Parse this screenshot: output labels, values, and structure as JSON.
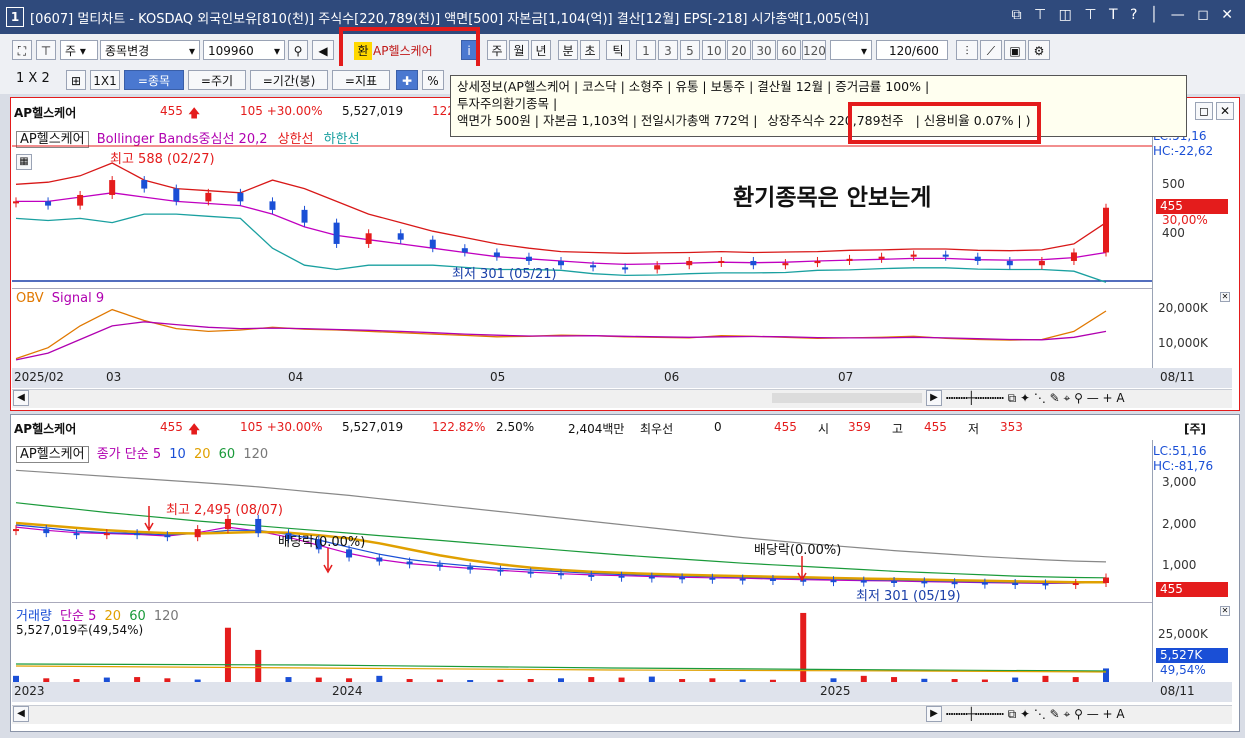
{
  "window": {
    "number": "1",
    "title": "[0607] 멀티차트 - KOSDAQ 외국인보유[810(천)] 주식수[220,789(천)] 액면[500] 자본금[1,104(억)] 결산[12월] EPS[-218] 시가총액[1,005(억)]",
    "icons": "⧉ ⊤ ◫ ⊤ T ? │ — ◻ ✕"
  },
  "toolbar1": {
    "period_sel": "주",
    "change_btn": "종목변경",
    "code": "109960",
    "badge": "환",
    "stock_name": "AP헬스케어",
    "tabs": [
      "주",
      "월",
      "년",
      "분",
      "초",
      "틱"
    ],
    "nums": [
      "1",
      "3",
      "5",
      "10",
      "20",
      "30",
      "60",
      "120"
    ],
    "count": "120",
    "total": "/600"
  },
  "toolbar2": {
    "layout1": "1 X 2",
    "layout2": "1X1",
    "b1": "=종목",
    "b2": "=주기",
    "b3": "=기간(봉)",
    "b4": "=지표"
  },
  "tooltip": {
    "line1": "상세정보(AP헬스케어  | 코스닥  | 소형주  | 유통  | 보통주  | 결산월 12월  | 증거금률 100%  |",
    "line2": "투자주의환기종목  |",
    "line3a": "액면가 500원  | 자본금 1,103억  | 전일시가총액 772억  |",
    "line3b": "상장주식수 220,789천주",
    "line3c": "|  신용비율 0.07%  |  )"
  },
  "annotation": "환기종목은 안보는게",
  "top_chart": {
    "name": "AP헬스케어",
    "price": "455",
    "change": "105 +30.00%",
    "volume": "5,527,019",
    "pct": "122",
    "legend_name": "AP헬스케어",
    "legend_bb": "Bollinger Bands중심선 20,2",
    "legend_up": "상한선",
    "legend_dn": "하한선",
    "high_label": "최고 588 (02/27)",
    "low_label": "최저 301 (05/21)",
    "lc": "LC:51,16",
    "hc": "HC:-22,62",
    "y_labels": [
      "500",
      "400"
    ],
    "price_tag": "455",
    "pct_tag": "30,00%",
    "obv_legend": "OBV",
    "obv_signal": "Signal 9",
    "obv_y": [
      "20,000K",
      "10,000K"
    ],
    "x_labels": [
      "2025/02",
      "03",
      "04",
      "05",
      "06",
      "07",
      "08"
    ],
    "date_end": "08/11",
    "bottom_icons": "┅┅┅┼┅┅┅┅ ⧉ ✦ ⋱ ✎ ⌖ ⚲ — + A"
  },
  "bottom_chart": {
    "name": "AP헬스케어",
    "price": "455",
    "change": "105 +30.00%",
    "volume": "5,527,019",
    "pct": "122.82%",
    "pct2": "2.50%",
    "amount": "2,404백만",
    "bid_label": "최우선",
    "bid": "0",
    "ask": "455",
    "open_l": "시",
    "open": "359",
    "high_l": "고",
    "high": "455",
    "low_l": "저",
    "low": "353",
    "unit": "[주]",
    "legend_name": "AP헬스케어",
    "legend_ma": "종가 단순 5",
    "ma": [
      "10",
      "20",
      "60",
      "120"
    ],
    "high_label": "최고 2,495 (08/07)",
    "div1": "배당락(0.00%)",
    "div2": "배당락(0.00%)",
    "low_label": "최저 301 (05/19)",
    "lc": "LC:51,16",
    "hc": "HC:-81,76",
    "y_labels": [
      "3,000",
      "2,000",
      "1,000"
    ],
    "price_tag": "455",
    "vol_legend": "거래량",
    "vol_ma": "단순 5",
    "vol_ma_list": [
      "20",
      "60",
      "120"
    ],
    "vol_value": "5,527,019주(49,54%)",
    "vol_y": [
      "25,000K"
    ],
    "vol_tag": "5,527K",
    "vol_pct_tag": "49,54%",
    "x_labels": [
      "2023",
      "2024",
      "2025"
    ],
    "date_end": "08/11",
    "bottom_icons": "┅┅┅┼┅┅┅┅ ⧉ ✦ ⋱ ✎ ⌖ ⚲ — + A"
  },
  "colors": {
    "up": "#e41c1c",
    "down": "#1a4fd6",
    "title_bg": "#2f4a7c",
    "highlight": "#e31b1b"
  },
  "chart_data": [
    {
      "type": "candlestick",
      "title": "AP헬스케어 (daily)",
      "x": [
        "2025/02",
        "03",
        "04",
        "05",
        "06",
        "07",
        "08"
      ],
      "y_range": [
        290,
        600
      ],
      "high": {
        "value": 588,
        "date": "02/27"
      },
      "low": {
        "value": 301,
        "date": "05/21"
      },
      "last": 455,
      "series": [
        {
          "name": "price_close_approx",
          "values": [
            470,
            460,
            485,
            520,
            500,
            470,
            490,
            470,
            450,
            420,
            370,
            395,
            380,
            360,
            350,
            340,
            330,
            320,
            315,
            310,
            320,
            330,
            330,
            320,
            325,
            330,
            335,
            340,
            345,
            340,
            330,
            320,
            330,
            350,
            455
          ]
        },
        {
          "name": "Bollinger Bands중심선 20,2",
          "values": [
            470,
            470,
            480,
            490,
            480,
            470,
            465,
            460,
            440,
            410,
            390,
            380,
            370,
            360,
            350,
            340,
            335,
            330,
            325,
            322,
            323,
            325,
            327,
            326,
            327,
            330,
            332,
            334,
            336,
            336,
            333,
            332,
            333,
            338,
            350
          ]
        },
        {
          "name": "상한선",
          "values": [
            510,
            515,
            530,
            560,
            520,
            500,
            495,
            490,
            520,
            500,
            470,
            440,
            420,
            400,
            385,
            370,
            360,
            352,
            350,
            348,
            349,
            350,
            352,
            350,
            351,
            352,
            355,
            356,
            358,
            358,
            355,
            354,
            356,
            370,
            420
          ]
        },
        {
          "name": "하한선",
          "values": [
            430,
            425,
            430,
            420,
            440,
            440,
            435,
            430,
            360,
            320,
            310,
            320,
            320,
            320,
            315,
            310,
            310,
            308,
            300,
            296,
            297,
            300,
            302,
            302,
            303,
            308,
            309,
            312,
            314,
            314,
            311,
            310,
            310,
            306,
            280
          ]
        }
      ]
    },
    {
      "type": "line",
      "title": "OBV Signal 9",
      "y_range": [
        0,
        25000
      ],
      "series": [
        {
          "name": "OBV",
          "values": [
            2000,
            6000,
            14000,
            20000,
            16000,
            13000,
            12000,
            12500,
            13500,
            12800,
            12500,
            12000,
            11500,
            11000,
            10500,
            10000,
            10200,
            10600,
            10400,
            10000,
            9800,
            9600,
            10400,
            10200,
            9800,
            9400,
            9600,
            9800,
            10200,
            9400,
            9000,
            8800,
            9000,
            12000,
            19500
          ]
        },
        {
          "name": "Signal 9",
          "values": [
            1500,
            4000,
            9000,
            14000,
            15500,
            14500,
            13500,
            13000,
            13200,
            13000,
            12700,
            12400,
            12000,
            11500,
            11000,
            10600,
            10300,
            10300,
            10400,
            10200,
            10000,
            9800,
            10000,
            10100,
            10000,
            9700,
            9600,
            9600,
            9800,
            9600,
            9300,
            9000,
            8900,
            9800,
            12000
          ]
        }
      ]
    },
    {
      "type": "candlestick",
      "title": "AP헬스케어 (weekly)",
      "x": [
        "2023",
        "2024",
        "2025"
      ],
      "y_range": [
        0,
        3600
      ],
      "high": {
        "value": 2495,
        "date": "08/07"
      },
      "low": {
        "value": 301,
        "date": "05/19"
      },
      "last": 455,
      "series": [
        {
          "name": "price_close_approx",
          "values": [
            1650,
            1550,
            1500,
            1550,
            1500,
            1450,
            1650,
            1900,
            1550,
            1400,
            1150,
            950,
            850,
            780,
            720,
            650,
            600,
            560,
            520,
            500,
            480,
            460,
            450,
            430,
            420,
            400,
            390,
            380,
            370,
            360,
            340,
            330,
            320,
            310,
            300,
            320,
            455
          ]
        },
        {
          "name": "종가 단순 5",
          "values": [
            1700,
            1620,
            1560,
            1540,
            1520,
            1480,
            1560,
            1700,
            1600,
            1450,
            1250,
            1050,
            900,
            800,
            740,
            680,
            630,
            590,
            550,
            520,
            500,
            480,
            460,
            450,
            440,
            420,
            405,
            390,
            380,
            370,
            355,
            340,
            330,
            320,
            310,
            315,
            350
          ]
        },
        {
          "name": "10",
          "values": [
            1750,
            1680,
            1600,
            1560,
            1540,
            1510,
            1540,
            1620,
            1620,
            1520,
            1380,
            1200,
            1030,
            900,
            810,
            740,
            680,
            640,
            600,
            560,
            530,
            510,
            490,
            475,
            460,
            445,
            430,
            415,
            400,
            390,
            375,
            360,
            345,
            335,
            325,
            320,
            330
          ]
        },
        {
          "name": "20",
          "values": [
            1800,
            1740,
            1680,
            1620,
            1580,
            1550,
            1540,
            1560,
            1580,
            1560,
            1500,
            1420,
            1300,
            1150,
            1000,
            880,
            780,
            700,
            640,
            600,
            570,
            545,
            525,
            505,
            490,
            475,
            460,
            445,
            430,
            420,
            405,
            390,
            375,
            360,
            350,
            340,
            340
          ]
        },
        {
          "name": "60",
          "values": [
            2300,
            2220,
            2140,
            2060,
            1990,
            1920,
            1850,
            1790,
            1730,
            1670,
            1610,
            1550,
            1490,
            1430,
            1370,
            1310,
            1250,
            1190,
            1130,
            1070,
            1010,
            960,
            910,
            860,
            810,
            770,
            730,
            690,
            650,
            610,
            580,
            550,
            520,
            490,
            470,
            455,
            450
          ]
        },
        {
          "name": "120",
          "values": [
            3100,
            3050,
            3000,
            2950,
            2900,
            2850,
            2800,
            2750,
            2690,
            2620,
            2550,
            2480,
            2400,
            2320,
            2240,
            2160,
            2080,
            2000,
            1920,
            1840,
            1760,
            1680,
            1600,
            1520,
            1440,
            1370,
            1300,
            1240,
            1180,
            1120,
            1070,
            1020,
            970,
            930,
            890,
            860,
            840
          ]
        }
      ]
    },
    {
      "type": "bar",
      "title": "거래량",
      "y_range": [
        0,
        30000
      ],
      "values": [
        2500,
        1500,
        1200,
        1800,
        2000,
        1500,
        1000,
        22000,
        13000,
        2000,
        1800,
        1500,
        2500,
        1200,
        1000,
        800,
        900,
        1200,
        1500,
        2000,
        1800,
        2200,
        1200,
        1500,
        1000,
        900,
        28000,
        1500,
        2500,
        2000,
        1300,
        1200,
        1000,
        1800,
        2500,
        2000,
        5500
      ]
    }
  ]
}
